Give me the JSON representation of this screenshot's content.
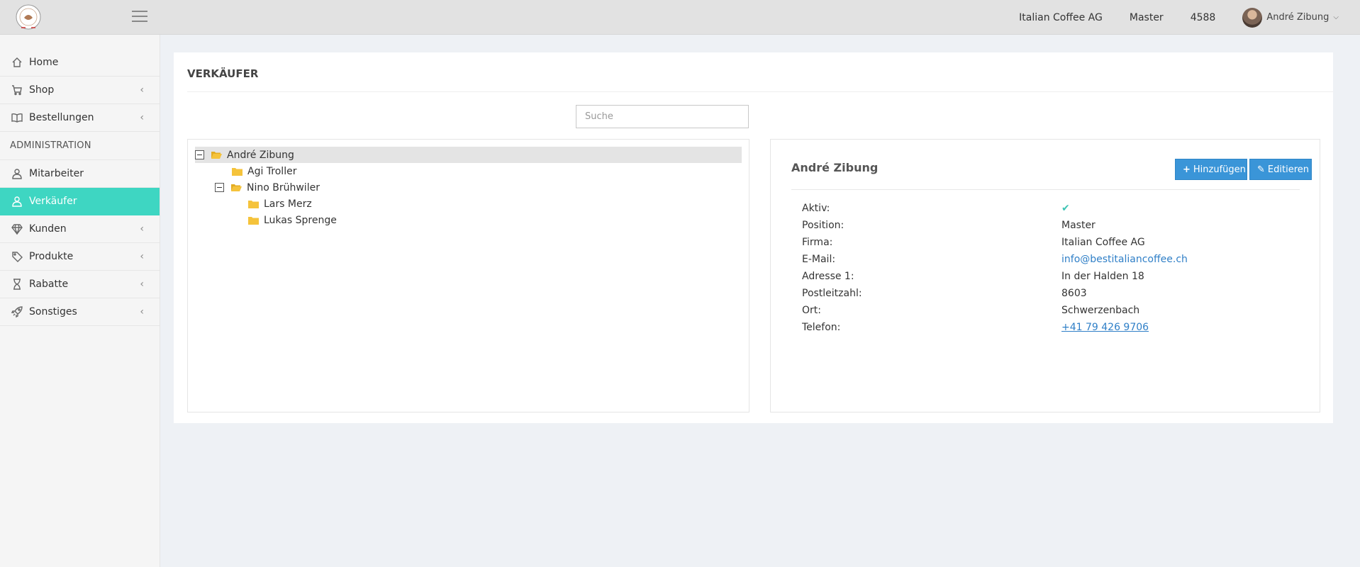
{
  "header": {
    "company": "Italian Coffee AG",
    "role": "Master",
    "number": "4588",
    "user_name": "André Zibung"
  },
  "sidebar": {
    "items": [
      {
        "label": "Home",
        "icon": "home-icon"
      },
      {
        "label": "Shop",
        "icon": "cart-icon"
      },
      {
        "label": "Bestellungen",
        "icon": "book-icon"
      }
    ],
    "heading": "ADMINISTRATION",
    "admin_items": [
      {
        "label": "Mitarbeiter",
        "icon": "user-icon"
      },
      {
        "label": "Verkäufer",
        "icon": "user-icon"
      },
      {
        "label": "Kunden",
        "icon": "diamond-icon"
      },
      {
        "label": "Produkte",
        "icon": "tag-icon"
      },
      {
        "label": "Rabatte",
        "icon": "hourglass-icon"
      },
      {
        "label": "Sonstiges",
        "icon": "rocket-icon"
      }
    ],
    "active": "Verkäufer"
  },
  "main": {
    "title": "VERKÄUFER",
    "search_placeholder": "Suche",
    "tree": [
      {
        "label": "André Zibung",
        "level": 0,
        "expanded": true,
        "selected": true
      },
      {
        "label": "Agi Troller",
        "level": 1
      },
      {
        "label": "Nino Brühwiler",
        "level": 1,
        "expanded": true
      },
      {
        "label": "Lars Merz",
        "level": 2
      },
      {
        "label": "Lukas Sprenge",
        "level": 2
      }
    ]
  },
  "detail": {
    "name": "André Zibung",
    "add_label": "Hinzufügen",
    "edit_label": "Editieren",
    "fields": [
      {
        "label": "Aktiv:",
        "value": "✔"
      },
      {
        "label": "Position:",
        "value": "Master"
      },
      {
        "label": "Firma:",
        "value": "Italian Coffee AG"
      },
      {
        "label": "E-Mail:",
        "value": "info@bestitaliancoffee.ch"
      },
      {
        "label": "Adresse 1:",
        "value": "In der Halden 18"
      },
      {
        "label": "Postleitzahl:",
        "value": "8603"
      },
      {
        "label": "Ort:",
        "value": "Schwerzenbach"
      },
      {
        "label": "Telefon:",
        "value": "+41 79 426 9706"
      }
    ]
  },
  "colors": {
    "accent": "#3ed6c2",
    "button": "#3a95d8",
    "link": "#2f7fc7",
    "folder": "#f5c33b"
  }
}
